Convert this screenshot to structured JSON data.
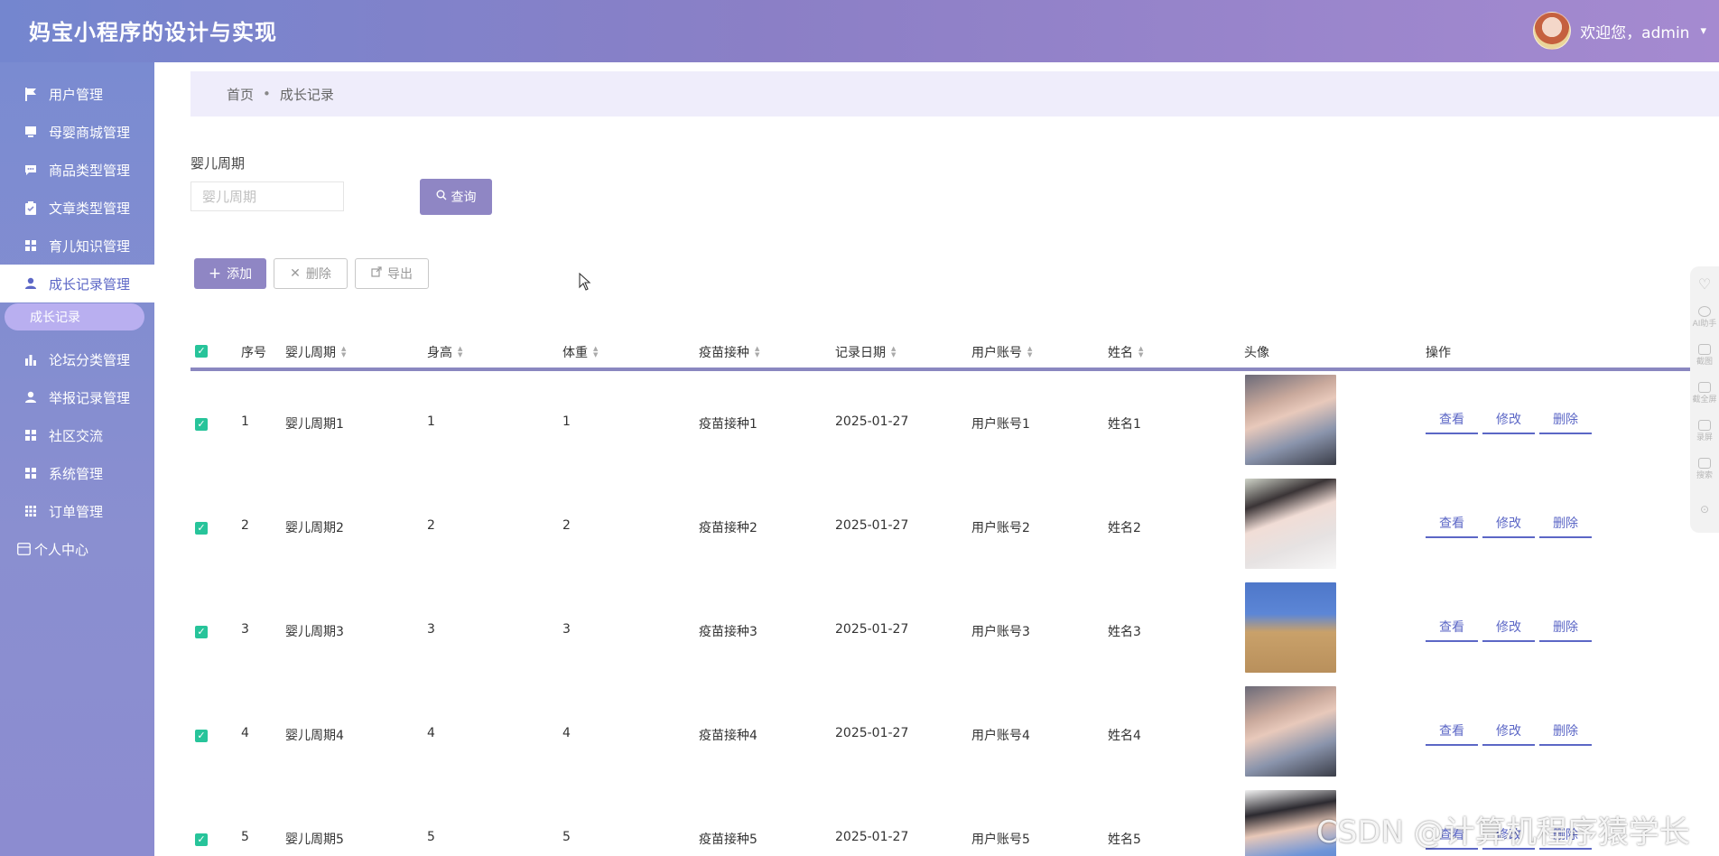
{
  "header": {
    "title": "妈宝小程序的设计与实现",
    "welcome": "欢迎您，admin",
    "caret": "▾"
  },
  "sidebar": {
    "items": [
      {
        "label": "用户管理",
        "icon": "flag-icon"
      },
      {
        "label": "母婴商城管理",
        "icon": "monitor-icon"
      },
      {
        "label": "商品类型管理",
        "icon": "chat-icon"
      },
      {
        "label": "文章类型管理",
        "icon": "clipboard-icon"
      },
      {
        "label": "育儿知识管理",
        "icon": "grid-icon"
      },
      {
        "label": "成长记录管理",
        "icon": "user-icon"
      },
      {
        "label": "论坛分类管理",
        "icon": "bar-chart-icon"
      },
      {
        "label": "举报记录管理",
        "icon": "user-icon"
      },
      {
        "label": "社区交流",
        "icon": "grid-icon"
      },
      {
        "label": "系统管理",
        "icon": "grid-icon"
      },
      {
        "label": "订单管理",
        "icon": "grid9-icon"
      },
      {
        "label": "个人中心",
        "icon": "window-icon"
      }
    ],
    "sub_item": "成长记录"
  },
  "breadcrumb": {
    "home": "首页",
    "sep": "•",
    "current": "成长记录"
  },
  "filter": {
    "label": "婴儿周期",
    "placeholder": "婴儿周期",
    "query_btn": "查询"
  },
  "toolbar": {
    "add": "添加",
    "delete": "删除",
    "export": "导出"
  },
  "table": {
    "columns": [
      "序号",
      "婴儿周期",
      "身高",
      "体重",
      "疫苗接种",
      "记录日期",
      "用户账号",
      "姓名",
      "头像",
      "操作"
    ],
    "rows": [
      {
        "index": "1",
        "period": "婴儿周期1",
        "height": "1",
        "weight": "1",
        "vaccine": "疫苗接种1",
        "date": "2025-01-27",
        "account": "用户账号1",
        "name": "姓名1"
      },
      {
        "index": "2",
        "period": "婴儿周期2",
        "height": "2",
        "weight": "2",
        "vaccine": "疫苗接种2",
        "date": "2025-01-27",
        "account": "用户账号2",
        "name": "姓名2"
      },
      {
        "index": "3",
        "period": "婴儿周期3",
        "height": "3",
        "weight": "3",
        "vaccine": "疫苗接种3",
        "date": "2025-01-27",
        "account": "用户账号3",
        "name": "姓名3"
      },
      {
        "index": "4",
        "period": "婴儿周期4",
        "height": "4",
        "weight": "4",
        "vaccine": "疫苗接种4",
        "date": "2025-01-27",
        "account": "用户账号4",
        "name": "姓名4"
      },
      {
        "index": "5",
        "period": "婴儿周期5",
        "height": "5",
        "weight": "5",
        "vaccine": "疫苗接种5",
        "date": "2025-01-27",
        "account": "用户账号5",
        "name": "姓名5"
      }
    ],
    "actions": {
      "view": "查看",
      "edit": "修改",
      "delete": "删除"
    }
  },
  "float_bar": [
    "AI助手",
    "截图",
    "截全屏",
    "录屏",
    "搜索"
  ],
  "watermark": "CSDN @计算机程序猿学长",
  "colors": {
    "accent": "#8f86c4",
    "link": "#5c67c6",
    "check": "#27c49a",
    "header_start": "#7486cf",
    "header_end": "#a58ad0"
  }
}
